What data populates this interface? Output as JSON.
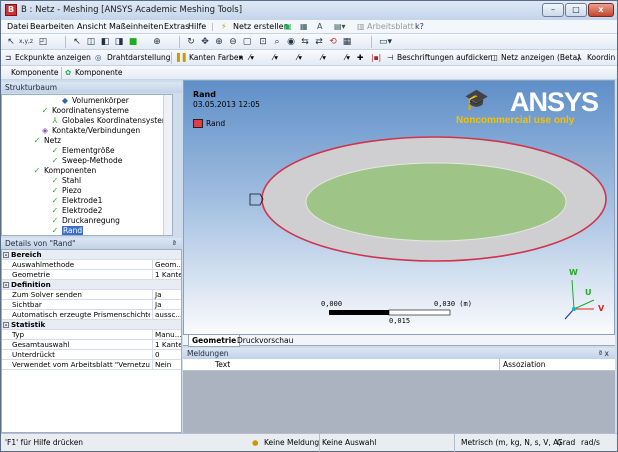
{
  "window": {
    "title": "B : Netz - Meshing [ANSYS Academic Meshing Tools]"
  },
  "menu": [
    "Datei",
    "Bearbeiten",
    "Ansicht",
    "Maßeinheiten",
    "Extras",
    "Hilfe"
  ],
  "toolbar1": {
    "netz_erstellen": "Netz erstellen",
    "arbeitsblatt": "Arbeitsblatt"
  },
  "toolbar3": {
    "eckpunkte": "Eckpunkte anzeigen",
    "drahtdarstellung": "Drahtdarstellung",
    "kanten_farben": "Kanten Farben",
    "beschriftungen": "Beschriftungen aufdicken",
    "netz_anzeigen": "Netz anzeigen (Beta)",
    "koordin": "Koordin"
  },
  "toolbar4": {
    "komponente1": "Komponente",
    "komponente2": "Komponente"
  },
  "tree": {
    "header": "Strukturbaum",
    "nodes": [
      {
        "label": "Volumenkörper"
      },
      {
        "label": "Koordinatensysteme"
      },
      {
        "label": "Globales Koordinatensystem"
      },
      {
        "label": "Kontakte/Verbindungen"
      },
      {
        "label": "Netz"
      },
      {
        "label": "Elementgröße"
      },
      {
        "label": "Sweep-Methode"
      },
      {
        "label": "Komponenten"
      },
      {
        "label": "Stahl"
      },
      {
        "label": "Piezo"
      },
      {
        "label": "Elektrode1"
      },
      {
        "label": "Elektrode2"
      },
      {
        "label": "Druckanregung"
      },
      {
        "label": "Rand"
      }
    ]
  },
  "details": {
    "header": "Details von \"Rand\"",
    "pin": "ª",
    "rows": [
      {
        "type": "group",
        "key": "Bereich"
      },
      {
        "key": "Auswahlmethode",
        "value": "Geom..."
      },
      {
        "key": "Geometrie",
        "value": "1 Kante"
      },
      {
        "type": "group",
        "key": "Definition"
      },
      {
        "key": "Zum Solver senden",
        "value": "Ja"
      },
      {
        "key": "Sichtbar",
        "value": "Ja"
      },
      {
        "key": "Automatisch erzeugte Prismenschichten",
        "value": "aussc..."
      },
      {
        "type": "group",
        "key": "Statistik"
      },
      {
        "key": "Typ",
        "value": "Manu..."
      },
      {
        "key": "Gesamtauswahl",
        "value": "1 Kante"
      },
      {
        "key": "Unterdrückt",
        "value": "0"
      },
      {
        "key": "Verwendet vom Arbeitsblatt \"Vernetzung\"",
        "value": "Nein"
      }
    ]
  },
  "viewport": {
    "title": "Rand",
    "date": "03.05.2013 12:05",
    "legend": "Rand",
    "legend_color": "#e23c4a",
    "logo": "ANSYS",
    "logo_sub": "Noncommercial use only",
    "scale_left": "0,000",
    "scale_right": "0,030 (m)",
    "scale_mid": "0,015",
    "axis_w": "W",
    "axis_u": "U",
    "axis_v": "V"
  },
  "vtabs": {
    "geometrie": "Geometrie",
    "druckvorschau": "Druckvorschau"
  },
  "messages": {
    "header": "Meldungen",
    "col_text": "Text",
    "col_assoc": "Assoziation",
    "pin": "ª x"
  },
  "status": {
    "help": "'F1' für Hilfe drücken",
    "meldung": "Keine Meldung",
    "auswahl": "Keine Auswahl",
    "units": "Metrisch (m, kg, N, s, V, A)",
    "grad": "Grad",
    "rad": "rad/s"
  }
}
